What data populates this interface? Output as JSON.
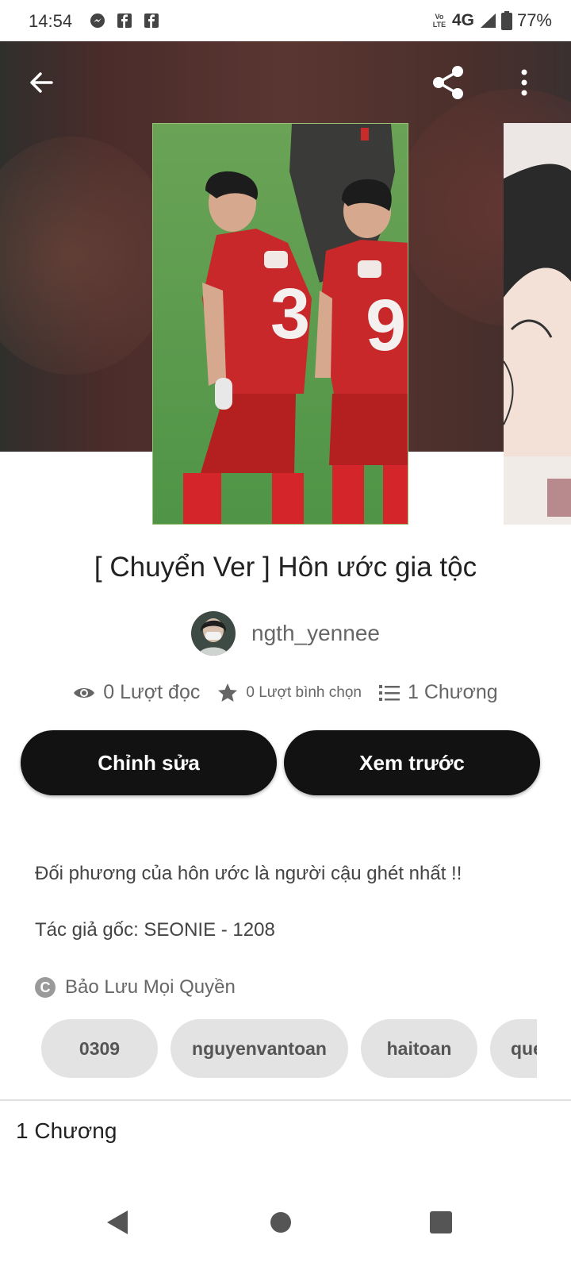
{
  "status_bar": {
    "time": "14:54",
    "network": "4G",
    "volte": "Vo LTE",
    "battery": "77%",
    "notification_icons": [
      "messenger-icon",
      "facebook-icon",
      "facebook-icon"
    ]
  },
  "header": {
    "back_icon": "arrow-left-icon",
    "share_icon": "share-icon",
    "menu_icon": "more-vertical-icon"
  },
  "story": {
    "title": "[ Chuyển Ver ] Hôn ước gia tộc",
    "author": "ngth_yennee",
    "stats": {
      "reads": "0 Lượt đọc",
      "votes": "0 Lượt bình chọn",
      "parts": "1 Chương"
    },
    "description": "Đối phương của hôn ước là người cậu ghét nhất !!",
    "original_author": "Tác giả gốc: SEONIE - 1208",
    "copyright": "Bảo Lưu Mọi Quyền",
    "tags": [
      "0309",
      "nguyenvantoan",
      "haitoan",
      "que"
    ]
  },
  "actions": {
    "edit_label": "Chỉnh sửa",
    "preview_label": "Xem trước"
  },
  "chapters": {
    "heading": "1 Chương"
  },
  "colors": {
    "button_bg": "#121212",
    "tag_bg": "#e3e3e3",
    "jersey_red": "#c8282a",
    "pitch_green": "#5fa04e"
  }
}
